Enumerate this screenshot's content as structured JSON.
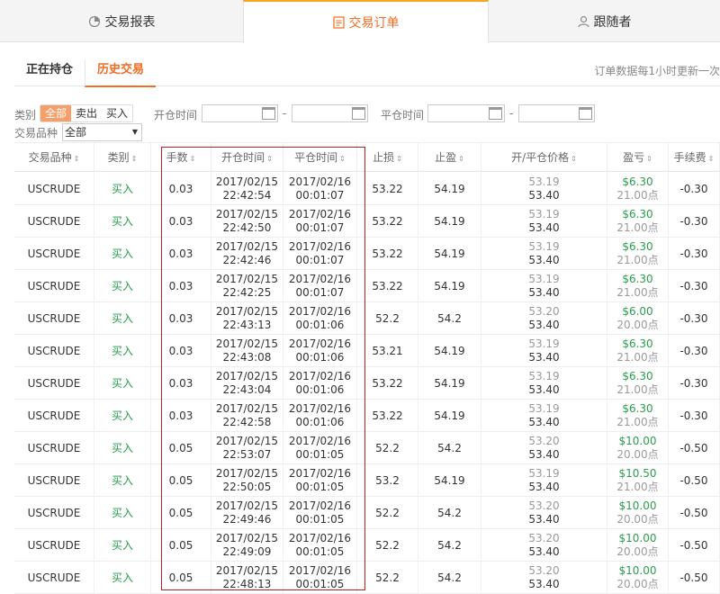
{
  "tabs": [
    {
      "label": "交易报表",
      "icon": "chart-pie-icon"
    },
    {
      "label": "交易订单",
      "icon": "document-icon"
    },
    {
      "label": "跟随者",
      "icon": "user-icon"
    }
  ],
  "subtabs": {
    "open": "正在持仓",
    "history": "历史交易"
  },
  "update_note": "订单数据每1小时更新一次",
  "filters": {
    "type_label": "类别",
    "type_options": [
      "全部",
      "卖出",
      "买入"
    ],
    "open_time_label": "开仓时间",
    "close_time_label": "平仓时间",
    "dash": "-",
    "symbol_label": "交易品种",
    "symbol_value": "全部"
  },
  "columns": [
    "交易品种",
    "类别",
    "手数",
    "开仓时间",
    "平仓时间",
    "止损",
    "止盈",
    "开/平仓价格",
    "盈亏",
    "手续费"
  ],
  "rows": [
    {
      "symbol": "USCRUDE",
      "side": "买入",
      "lots": "0.03",
      "open_date": "2017/02/15",
      "open_time": "22:42:54",
      "close_date": "2017/02/16",
      "close_time": "00:01:07",
      "sl": "53.22",
      "tp": "54.19",
      "open_price": "53.19",
      "close_price": "53.40",
      "pl": "$6.30",
      "pts": "21.00点",
      "fee": "-0.30"
    },
    {
      "symbol": "USCRUDE",
      "side": "买入",
      "lots": "0.03",
      "open_date": "2017/02/15",
      "open_time": "22:42:50",
      "close_date": "2017/02/16",
      "close_time": "00:01:07",
      "sl": "53.22",
      "tp": "54.19",
      "open_price": "53.19",
      "close_price": "53.40",
      "pl": "$6.30",
      "pts": "21.00点",
      "fee": "-0.30"
    },
    {
      "symbol": "USCRUDE",
      "side": "买入",
      "lots": "0.03",
      "open_date": "2017/02/15",
      "open_time": "22:42:46",
      "close_date": "2017/02/16",
      "close_time": "00:01:07",
      "sl": "53.22",
      "tp": "54.19",
      "open_price": "53.19",
      "close_price": "53.40",
      "pl": "$6.30",
      "pts": "21.00点",
      "fee": "-0.30"
    },
    {
      "symbol": "USCRUDE",
      "side": "买入",
      "lots": "0.03",
      "open_date": "2017/02/15",
      "open_time": "22:42:25",
      "close_date": "2017/02/16",
      "close_time": "00:01:07",
      "sl": "53.22",
      "tp": "54.19",
      "open_price": "53.19",
      "close_price": "53.40",
      "pl": "$6.30",
      "pts": "21.00点",
      "fee": "-0.30"
    },
    {
      "symbol": "USCRUDE",
      "side": "买入",
      "lots": "0.03",
      "open_date": "2017/02/15",
      "open_time": "22:43:13",
      "close_date": "2017/02/16",
      "close_time": "00:01:06",
      "sl": "52.2",
      "tp": "54.2",
      "open_price": "53.20",
      "close_price": "53.40",
      "pl": "$6.00",
      "pts": "20.00点",
      "fee": "-0.30"
    },
    {
      "symbol": "USCRUDE",
      "side": "买入",
      "lots": "0.03",
      "open_date": "2017/02/15",
      "open_time": "22:43:08",
      "close_date": "2017/02/16",
      "close_time": "00:01:06",
      "sl": "53.21",
      "tp": "54.19",
      "open_price": "53.19",
      "close_price": "53.40",
      "pl": "$6.30",
      "pts": "21.00点",
      "fee": "-0.30"
    },
    {
      "symbol": "USCRUDE",
      "side": "买入",
      "lots": "0.03",
      "open_date": "2017/02/15",
      "open_time": "22:43:04",
      "close_date": "2017/02/16",
      "close_time": "00:01:06",
      "sl": "53.22",
      "tp": "54.19",
      "open_price": "53.19",
      "close_price": "53.40",
      "pl": "$6.30",
      "pts": "21.00点",
      "fee": "-0.30"
    },
    {
      "symbol": "USCRUDE",
      "side": "买入",
      "lots": "0.03",
      "open_date": "2017/02/15",
      "open_time": "22:42:58",
      "close_date": "2017/02/16",
      "close_time": "00:01:06",
      "sl": "53.22",
      "tp": "54.19",
      "open_price": "53.19",
      "close_price": "53.40",
      "pl": "$6.30",
      "pts": "21.00点",
      "fee": "-0.30"
    },
    {
      "symbol": "USCRUDE",
      "side": "买入",
      "lots": "0.05",
      "open_date": "2017/02/15",
      "open_time": "22:53:07",
      "close_date": "2017/02/16",
      "close_time": "00:01:05",
      "sl": "52.2",
      "tp": "54.2",
      "open_price": "53.20",
      "close_price": "53.40",
      "pl": "$10.00",
      "pts": "20.00点",
      "fee": "-0.50"
    },
    {
      "symbol": "USCRUDE",
      "side": "买入",
      "lots": "0.05",
      "open_date": "2017/02/15",
      "open_time": "22:50:05",
      "close_date": "2017/02/16",
      "close_time": "00:01:05",
      "sl": "53.2",
      "tp": "54.19",
      "open_price": "53.19",
      "close_price": "53.40",
      "pl": "$10.50",
      "pts": "21.00点",
      "fee": "-0.50"
    },
    {
      "symbol": "USCRUDE",
      "side": "买入",
      "lots": "0.05",
      "open_date": "2017/02/15",
      "open_time": "22:49:46",
      "close_date": "2017/02/16",
      "close_time": "00:01:05",
      "sl": "52.2",
      "tp": "54.2",
      "open_price": "53.20",
      "close_price": "53.40",
      "pl": "$10.00",
      "pts": "20.00点",
      "fee": "-0.50"
    },
    {
      "symbol": "USCRUDE",
      "side": "买入",
      "lots": "0.05",
      "open_date": "2017/02/15",
      "open_time": "22:49:09",
      "close_date": "2017/02/16",
      "close_time": "00:01:05",
      "sl": "52.2",
      "tp": "54.2",
      "open_price": "53.20",
      "close_price": "53.40",
      "pl": "$10.00",
      "pts": "20.00点",
      "fee": "-0.50"
    },
    {
      "symbol": "USCRUDE",
      "side": "买入",
      "lots": "0.05",
      "open_date": "2017/02/15",
      "open_time": "22:48:13",
      "close_date": "2017/02/16",
      "close_time": "00:01:05",
      "sl": "52.2",
      "tp": "54.2",
      "open_price": "53.20",
      "close_price": "53.40",
      "pl": "$10.00",
      "pts": "20.00点",
      "fee": "-0.50"
    }
  ]
}
